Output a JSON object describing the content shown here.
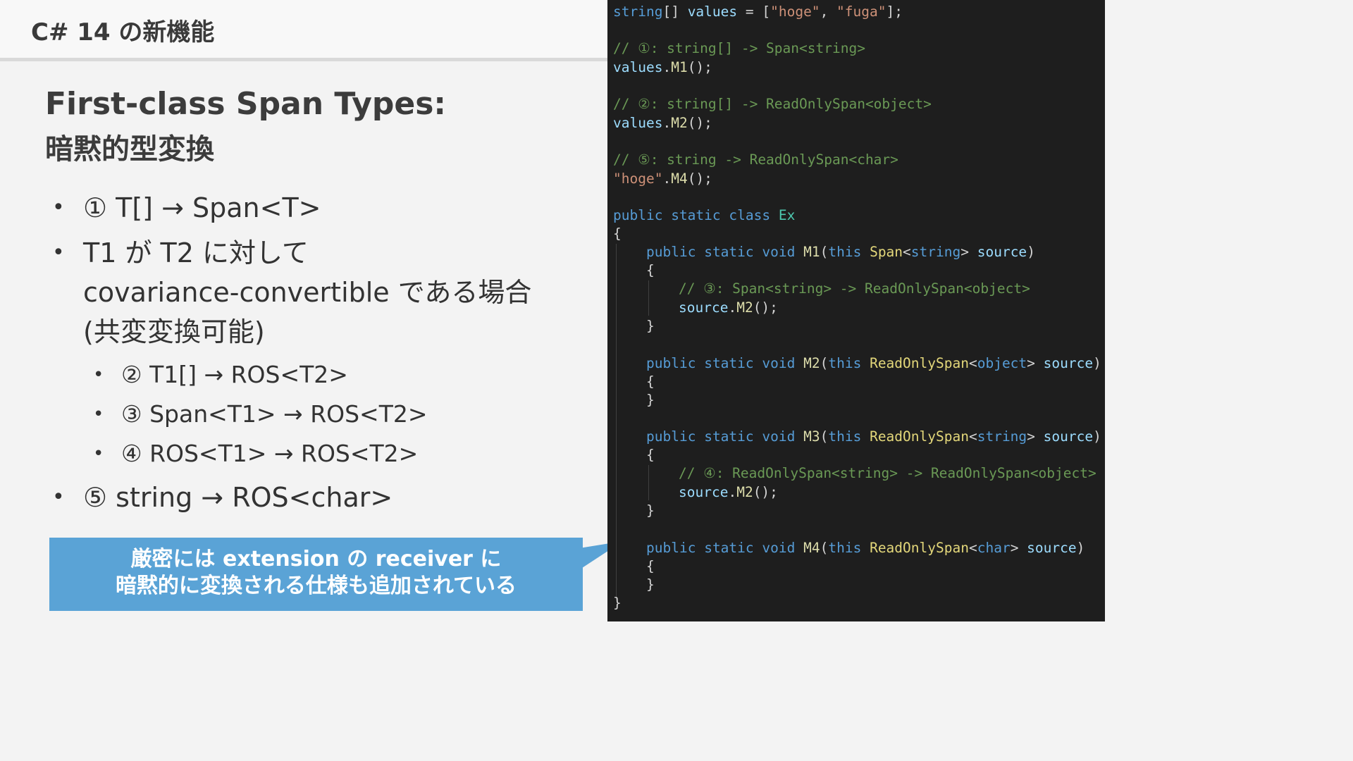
{
  "header": {
    "title": "C# 14 の新機能"
  },
  "slide": {
    "title": "First-class Span Types:",
    "subtitle": "暗黙的型変換",
    "bullets": [
      {
        "text": "① T[] → Span<T>"
      },
      {
        "line1": "T1 が T2 に対して",
        "line2": "covariance-convertible である場合",
        "line3": "(共変変換可能)"
      },
      {
        "text": "② T1[] → ROS<T2>"
      },
      {
        "text": "③ Span<T1> → ROS<T2>"
      },
      {
        "text": "④ ROS<T1> → ROS<T2>"
      },
      {
        "text": "⑤ string → ROS<char>"
      }
    ],
    "bullet_symbol": "•",
    "callout": {
      "line1": "厳密には extension の receiver に",
      "line2": "暗黙的に変換される仕様も追加されている"
    }
  },
  "code_lines": [
    [
      "string",
      "[] ",
      "values",
      " = [",
      "\"hoge\"",
      ", ",
      "\"fuga\"",
      "];"
    ],
    [
      "// ①: string[] -> Span<string>"
    ],
    [
      "values",
      ".",
      "M1",
      "();"
    ],
    [
      "// ②: string[] -> ReadOnlySpan<object>"
    ],
    [
      "values",
      ".",
      "M2",
      "();"
    ],
    [
      "// ⑤: string -> ReadOnlySpan<char>"
    ],
    [
      "\"hoge\"",
      ".",
      "M4",
      "();"
    ],
    [
      "public",
      " ",
      "static",
      " ",
      "class",
      " ",
      "Ex"
    ],
    [
      "{"
    ],
    [
      "public",
      " ",
      "static",
      " ",
      "void",
      " ",
      "M1",
      "(",
      "this",
      " ",
      "Span",
      "<",
      "string",
      "> ",
      "source",
      ")"
    ],
    [
      "{"
    ],
    [
      "// ③: Span<string> -> ReadOnlySpan<object>"
    ],
    [
      "source",
      ".",
      "M2",
      "();"
    ],
    [
      "}"
    ],
    [
      "public",
      " ",
      "static",
      " ",
      "void",
      " ",
      "M2",
      "(",
      "this",
      " ",
      "ReadOnlySpan",
      "<",
      "object",
      "> ",
      "source",
      ")"
    ],
    [
      "{"
    ],
    [
      "}"
    ],
    [
      "public",
      " ",
      "static",
      " ",
      "void",
      " ",
      "M3",
      "(",
      "this",
      " ",
      "ReadOnlySpan",
      "<",
      "string",
      "> ",
      "source",
      ")"
    ],
    [
      "{"
    ],
    [
      "// ④: ReadOnlySpan<string> -> ReadOnlySpan<object>"
    ],
    [
      "source",
      ".",
      "M2",
      "();"
    ],
    [
      "}"
    ],
    [
      "public",
      " ",
      "static",
      " ",
      "void",
      " ",
      "M4",
      "(",
      "this",
      " ",
      "ReadOnlySpan",
      "<",
      "char",
      "> ",
      "source",
      ")"
    ],
    [
      "{"
    ],
    [
      "}"
    ],
    [
      "}"
    ]
  ],
  "colors": {
    "slide_bg": "#f3f3f3",
    "callout_bg": "#5aa3d6",
    "editor_bg": "#1e1e1e",
    "keyword": "#569cd6",
    "string": "#ce9178",
    "comment": "#6a9955",
    "method": "#dcdcaa",
    "type": "#4ec9b0",
    "span_type": "#e3d77a",
    "variable": "#9cdcfe"
  }
}
